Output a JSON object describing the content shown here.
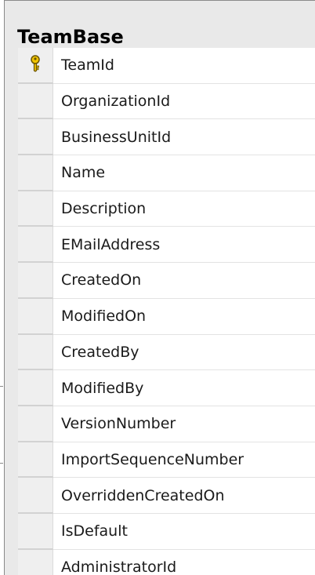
{
  "table": {
    "title": "TeamBase",
    "columns": [
      {
        "label": "TeamId",
        "is_key": true,
        "icon": "key-icon"
      },
      {
        "label": "OrganizationId",
        "is_key": false
      },
      {
        "label": "BusinessUnitId",
        "is_key": false
      },
      {
        "label": "Name",
        "is_key": false
      },
      {
        "label": "Description",
        "is_key": false
      },
      {
        "label": "EMailAddress",
        "is_key": false
      },
      {
        "label": "CreatedOn",
        "is_key": false
      },
      {
        "label": "ModifiedOn",
        "is_key": false
      },
      {
        "label": "CreatedBy",
        "is_key": false
      },
      {
        "label": "ModifiedBy",
        "is_key": false
      },
      {
        "label": "VersionNumber",
        "is_key": false
      },
      {
        "label": "ImportSequenceNumber",
        "is_key": false
      },
      {
        "label": "OverriddenCreatedOn",
        "is_key": false
      },
      {
        "label": "IsDefault",
        "is_key": false
      },
      {
        "label": "AdministratorId",
        "is_key": false
      }
    ]
  },
  "colors": {
    "key_icon_fill": "#f2c500",
    "key_icon_stroke": "#6b5500",
    "header_background": "#e9e9e9",
    "row_background": "#ffffff",
    "selector_background": "#efefef"
  }
}
